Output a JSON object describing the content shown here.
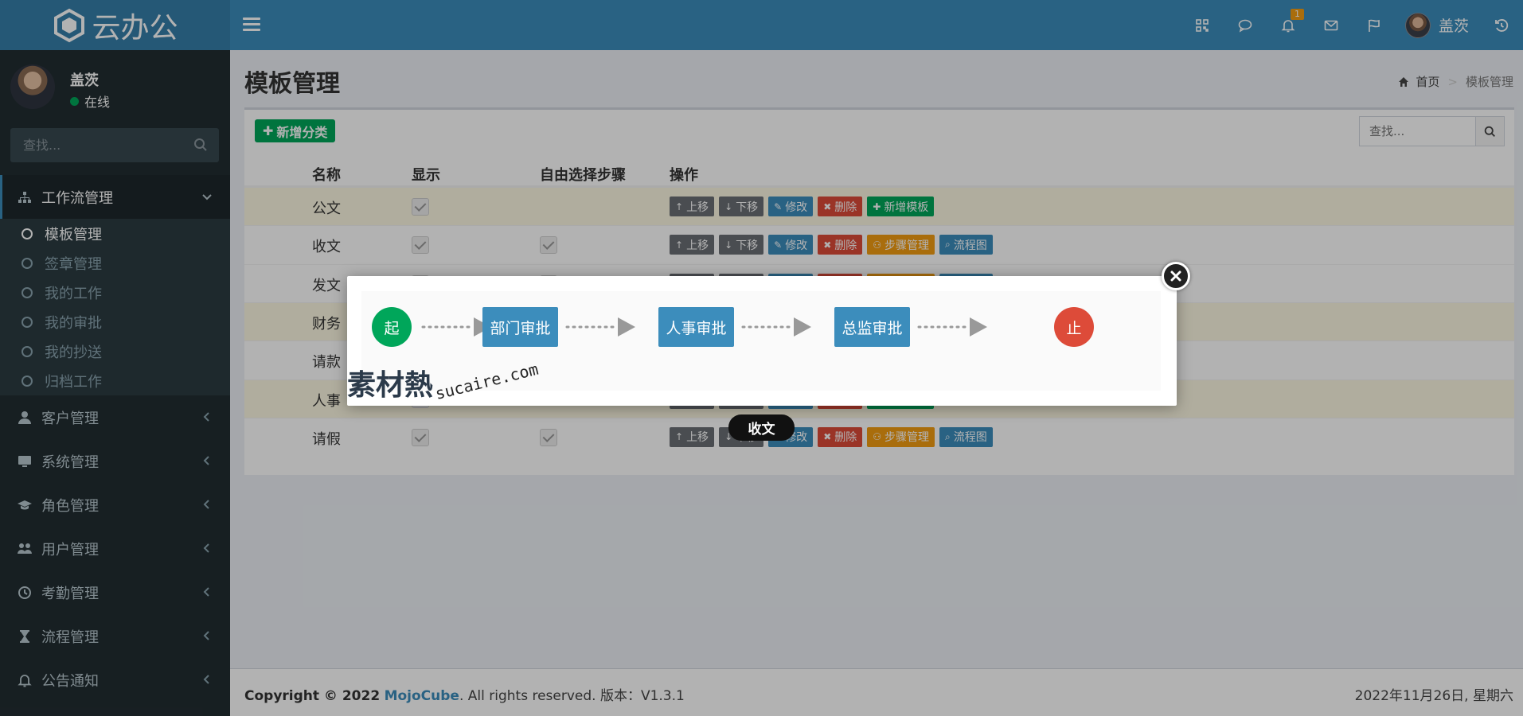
{
  "header": {
    "logo_text": "云办公",
    "notification_count": "1",
    "user_name": "盖茨",
    "icons": [
      "qrcode-icon",
      "chat-icon",
      "bell-icon",
      "envelope-icon",
      "flag-icon",
      "logout-icon"
    ]
  },
  "sidebar": {
    "user_name": "盖茨",
    "status": "在线",
    "search_placeholder": "查找...",
    "menu": [
      {
        "label": "工作流管理",
        "icon": "sitemap-icon",
        "expanded": true
      },
      {
        "label": "客户管理",
        "icon": "user-icon"
      },
      {
        "label": "系统管理",
        "icon": "desktop-icon"
      },
      {
        "label": "角色管理",
        "icon": "graduation-cap-icon"
      },
      {
        "label": "用户管理",
        "icon": "users-icon"
      },
      {
        "label": "考勤管理",
        "icon": "clock-icon"
      },
      {
        "label": "流程管理",
        "icon": "hourglass-icon"
      },
      {
        "label": "公告通知",
        "icon": "bell-icon"
      }
    ],
    "submenu": [
      "模板管理",
      "签章管理",
      "我的工作",
      "我的审批",
      "我的抄送",
      "归档工作"
    ]
  },
  "content": {
    "title": "模板管理",
    "breadcrumb": {
      "home": "首页",
      "current": "模板管理"
    },
    "add_category": "新增分类",
    "search_placeholder": "查找...",
    "columns": [
      "名称",
      "显示",
      "自由选择步骤",
      "操作"
    ],
    "op_labels": {
      "up": "上移",
      "down": "下移",
      "edit": "修改",
      "del": "删除",
      "add_template": "新增模板",
      "steps": "步骤管理",
      "flowchart": "流程图"
    },
    "rows": [
      {
        "name": "公文",
        "show": true,
        "free": false,
        "type": "category"
      },
      {
        "name": "收文",
        "show": true,
        "free": true,
        "type": "template"
      },
      {
        "name": "发文",
        "show": true,
        "free": true,
        "type": "template"
      },
      {
        "name": "财务",
        "show": true,
        "free": false,
        "type": "category"
      },
      {
        "name": "请款",
        "show": true,
        "free": true,
        "type": "template"
      },
      {
        "name": "人事",
        "show": true,
        "free": false,
        "type": "category"
      },
      {
        "name": "请假",
        "show": true,
        "free": true,
        "type": "template"
      }
    ]
  },
  "modal": {
    "start": "起",
    "steps": [
      "部门审批",
      "人事审批",
      "总监审批"
    ],
    "end": "止",
    "caption": "收文"
  },
  "watermark": {
    "cn": "素材熱",
    "en": "sucaire.com"
  },
  "footer": {
    "copyright_prefix": "Copyright © 2022",
    "brand": "MojoCube",
    "rights": ". All rights reserved. 版本：V1.3.1",
    "date": "2022年11月26日, 星期六"
  },
  "colors": {
    "header": "#3c8dbc",
    "logo_bg": "#367fa9",
    "sidebar": "#222d32",
    "green": "#00a65a",
    "red": "#dd4b39",
    "orange": "#f39c12",
    "highlight_row": "#fcf8e3"
  }
}
